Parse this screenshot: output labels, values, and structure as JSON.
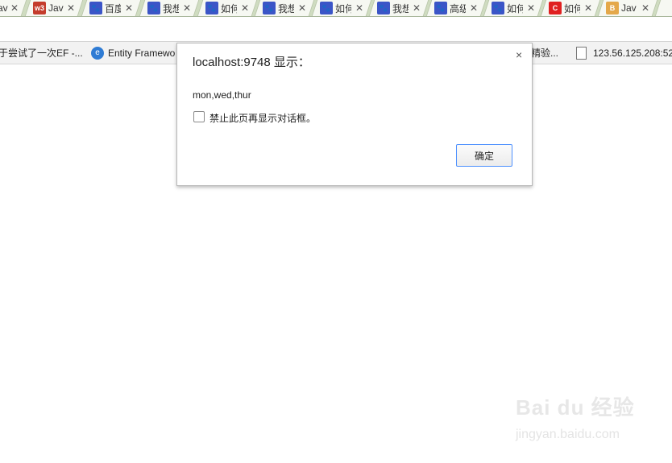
{
  "tabs": [
    {
      "title": "Jav",
      "icon": "blank-icon",
      "favtext": ""
    },
    {
      "title": "Jav",
      "icon": "w3school-icon",
      "favtext": "w3"
    },
    {
      "title": "百度",
      "icon": "baidu-paw-icon",
      "favtext": "🐾"
    },
    {
      "title": "我想",
      "icon": "baidu-paw-icon",
      "favtext": "🐾"
    },
    {
      "title": "如何",
      "icon": "baidu-paw-icon",
      "favtext": "🐾"
    },
    {
      "title": "我想",
      "icon": "baidu-paw-icon",
      "favtext": "🐾"
    },
    {
      "title": "如何",
      "icon": "baidu-paw-icon",
      "favtext": "🐾"
    },
    {
      "title": "我想",
      "icon": "baidu-paw-icon",
      "favtext": "🐾"
    },
    {
      "title": "高级",
      "icon": "baidu-paw-icon",
      "favtext": "🐾"
    },
    {
      "title": "如何",
      "icon": "baidu-paw-icon",
      "favtext": "🐾"
    },
    {
      "title": "如何",
      "icon": "csdn-icon",
      "favtext": "C"
    },
    {
      "title": "Jav",
      "icon": "js-icon",
      "favtext": "B"
    }
  ],
  "bookmarks": [
    {
      "label": "于尝试了一次EF -...",
      "icon": "none"
    },
    {
      "label": "Entity Framewo",
      "icon": "ie-icon"
    },
    {
      "label": "精验...",
      "icon": "none"
    },
    {
      "label": "123.56.125.208:52",
      "icon": "page-icon"
    }
  ],
  "dialog": {
    "title": "localhost:9748 显示：",
    "close": "×",
    "message": "mon,wed,thur",
    "checkbox_label": "禁止此页再显示对话框。",
    "ok_label": "确定"
  },
  "watermark": {
    "logo": "Bai du 经验",
    "url": "jingyan.baidu.com"
  }
}
